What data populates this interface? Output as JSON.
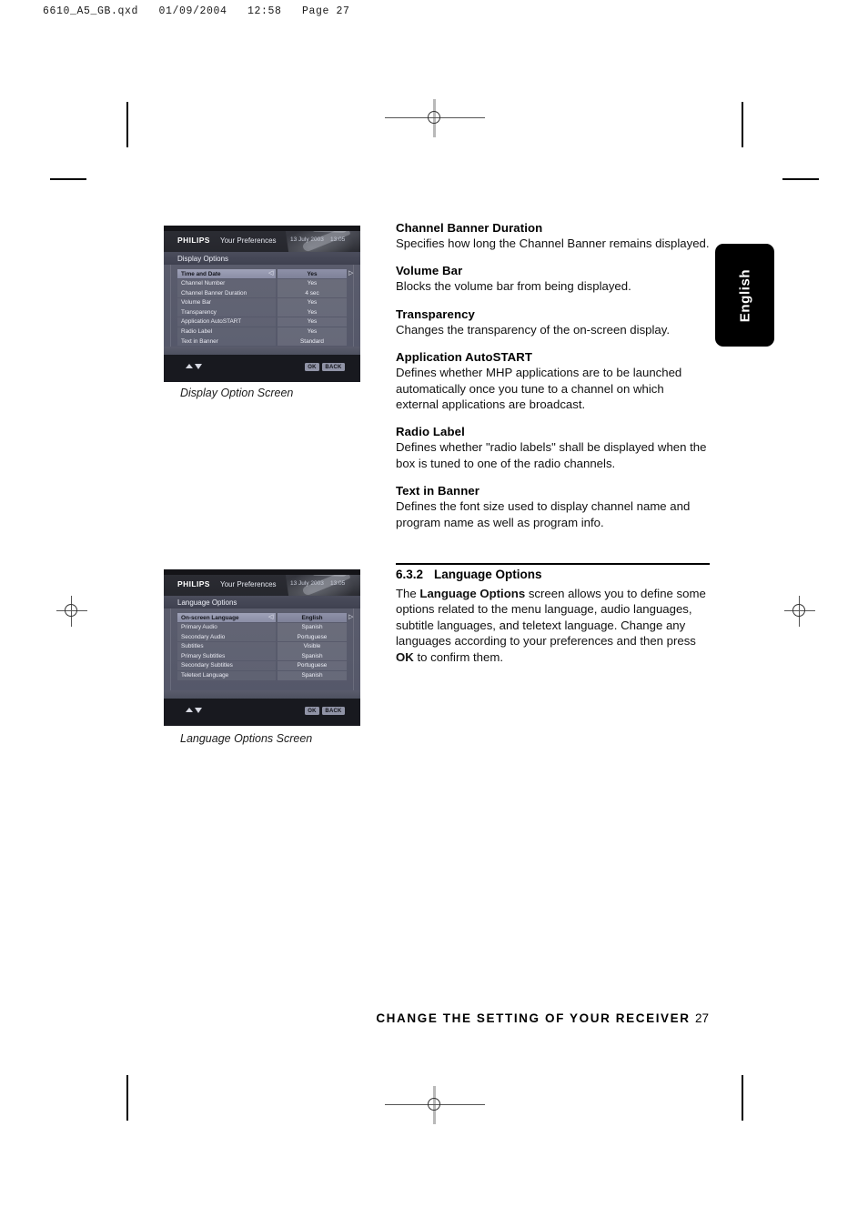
{
  "print_header": "6610_A5_GB.qxd   01/09/2004   12:58   Page 27",
  "side_tab": {
    "label": "English"
  },
  "screens": [
    {
      "caption": "Display Option Screen",
      "brand": "PHILIPS",
      "app_title": "Your Preferences",
      "date": "13 July 2003",
      "time": "13:05",
      "subtitle": "Display Options",
      "arrow_left": "◁",
      "arrow_right": "▷",
      "ok_label": "OK",
      "back_label": "BACK",
      "rows": [
        {
          "label": "Time and Date",
          "value": "Yes",
          "selected": true
        },
        {
          "label": "Channel Number",
          "value": "Yes",
          "selected": false
        },
        {
          "label": "Channel Banner Duration",
          "value": "4 sec",
          "selected": false
        },
        {
          "label": "Volume Bar",
          "value": "Yes",
          "selected": false
        },
        {
          "label": "Transparency",
          "value": "Yes",
          "selected": false
        },
        {
          "label": "Application AutoSTART",
          "value": "Yes",
          "selected": false
        },
        {
          "label": "Radio Label",
          "value": "Yes",
          "selected": false
        },
        {
          "label": "Text in Banner",
          "value": "Standard",
          "selected": false
        }
      ]
    },
    {
      "caption": "Language Options Screen",
      "brand": "PHILIPS",
      "app_title": "Your Preferences",
      "date": "13 July 2003",
      "time": "13:05",
      "subtitle": "Language Options",
      "arrow_left": "◁",
      "arrow_right": "▷",
      "ok_label": "OK",
      "back_label": "BACK",
      "rows": [
        {
          "label": "On-screen Language",
          "value": "English",
          "selected": true
        },
        {
          "label": "Primary Audio",
          "value": "Spanish",
          "selected": false
        },
        {
          "label": "Secondary Audio",
          "value": "Portuguese",
          "selected": false
        },
        {
          "label": "Subtitles",
          "value": "Visible",
          "selected": false
        },
        {
          "label": "Primary Subtitles",
          "value": "Spanish",
          "selected": false
        },
        {
          "label": "Secondary Subtitles",
          "value": "Portuguese",
          "selected": false
        },
        {
          "label": "Teletext Language",
          "value": "Spanish",
          "selected": false
        }
      ]
    }
  ],
  "sections": [
    {
      "heading": "Channel Banner Duration",
      "body": "Specifies how long the Channel Banner remains displayed."
    },
    {
      "heading": "Volume Bar",
      "body": "Blocks the volume bar from being displayed."
    },
    {
      "heading": "Transparency",
      "body": "Changes the transparency of the on-screen display."
    },
    {
      "heading": "Application AutoSTART",
      "body": "Defines whether MHP applications are to be launched automatically once you tune to a channel on which external applications are broadcast."
    },
    {
      "heading": "Radio Label",
      "body": "Defines whether \"radio labels\" shall be displayed when the box is tuned to one of the radio channels."
    },
    {
      "heading": "Text in Banner",
      "body": "Defines the font size used to display channel name and program name as well as program info."
    }
  ],
  "subsection": {
    "number": "6.3.2",
    "title": "Language Options",
    "paragraph_part1": "The ",
    "paragraph_bold1": "Language Options",
    "paragraph_part2": " screen allows you to define some options related to the menu language, audio languages, subtitle languages, and teletext language. Change any languages according to your preferences and then press ",
    "paragraph_bold2": "OK",
    "paragraph_part3": " to confirm them."
  },
  "footer": {
    "text": "CHANGE THE SETTING OF YOUR RECEIVER",
    "page": "27"
  }
}
